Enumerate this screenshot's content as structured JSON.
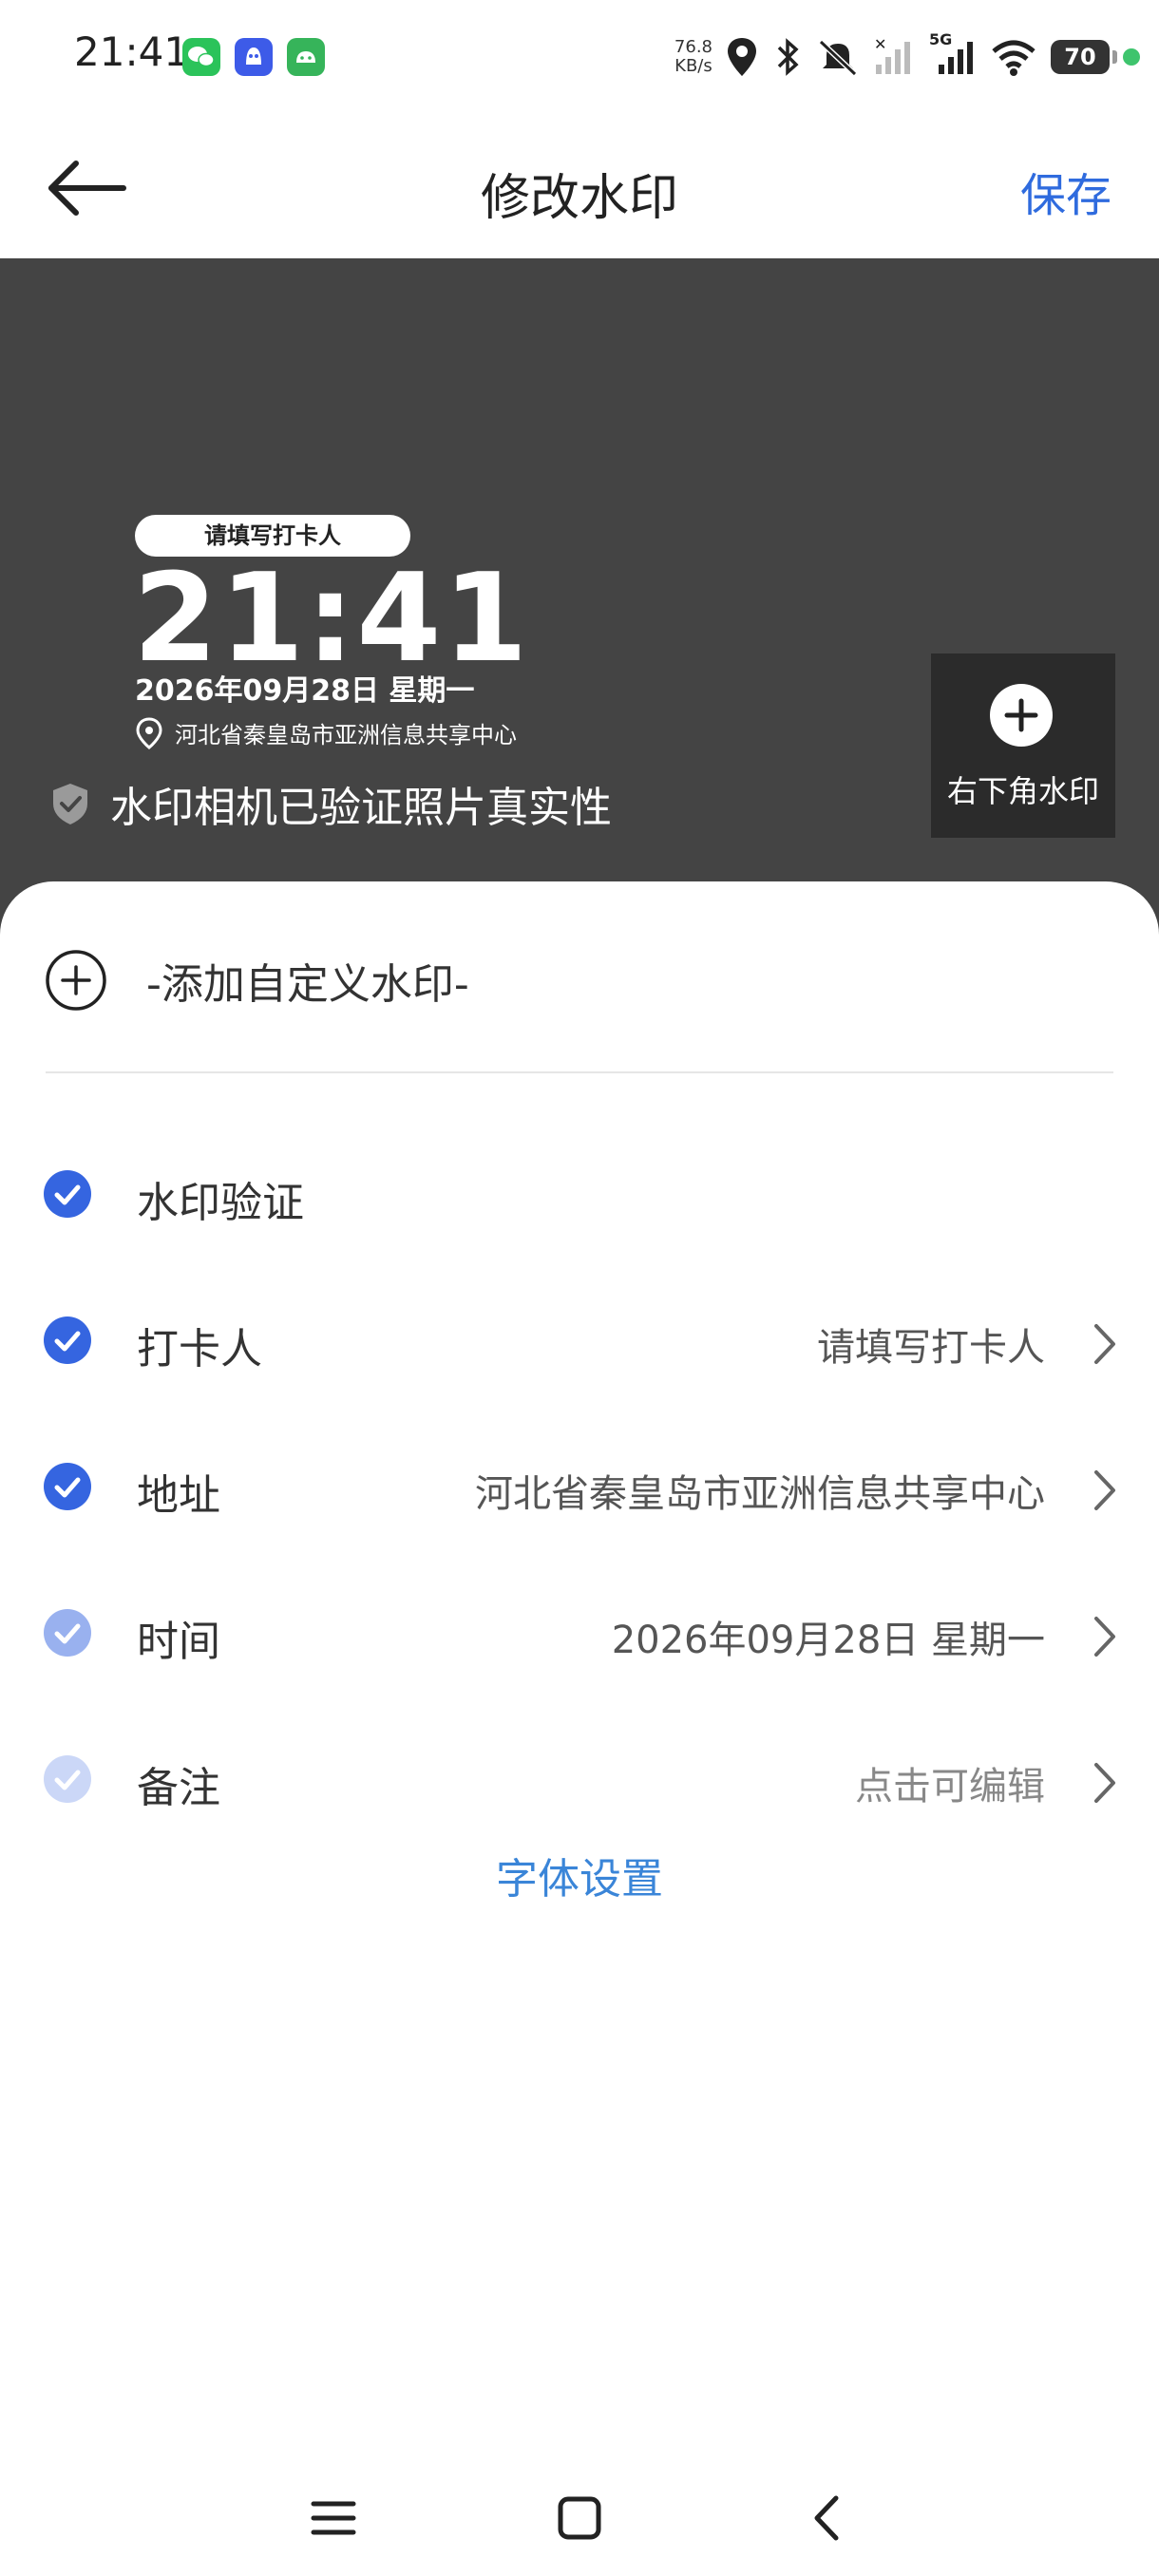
{
  "status_bar": {
    "time": "21:41",
    "speed_value": "76.8",
    "speed_unit": "KB/s",
    "network": "5G",
    "battery": "70",
    "apps": [
      "wechat-icon",
      "qq-icon",
      "android-icon"
    ]
  },
  "navbar": {
    "title": "修改水印",
    "save_label": "保存"
  },
  "preview": {
    "checkin_pill": "请填写打卡人",
    "time": "21:41",
    "date": "2026年09月28日 星期一",
    "location": "河北省秦皇岛市亚洲信息共享中心",
    "verify_text": "水印相机已验证照片真实性",
    "corner_button_label": "右下角水印"
  },
  "sheet": {
    "add_custom_label": "-添加自定义水印-",
    "items": [
      {
        "label": "水印验证",
        "value": "",
        "checked": true,
        "opacity": 1.0
      },
      {
        "label": "打卡人",
        "value": "请填写打卡人",
        "checked": true,
        "opacity": 1.0
      },
      {
        "label": "地址",
        "value": "河北省秦皇岛市亚洲信息共享中心",
        "checked": true,
        "opacity": 1.0
      },
      {
        "label": "时间",
        "value": "2026年09月28日 星期一",
        "checked": true,
        "opacity": 0.5
      },
      {
        "label": "备注",
        "value": "点击可编辑",
        "checked": true,
        "opacity": 0.25
      }
    ],
    "font_settings_label": "字体设置"
  },
  "colors": {
    "accent": "#2f6bde",
    "check_blue": "#3565e0",
    "preview_bg": "#444444",
    "link_blue": "#3a85d8"
  }
}
